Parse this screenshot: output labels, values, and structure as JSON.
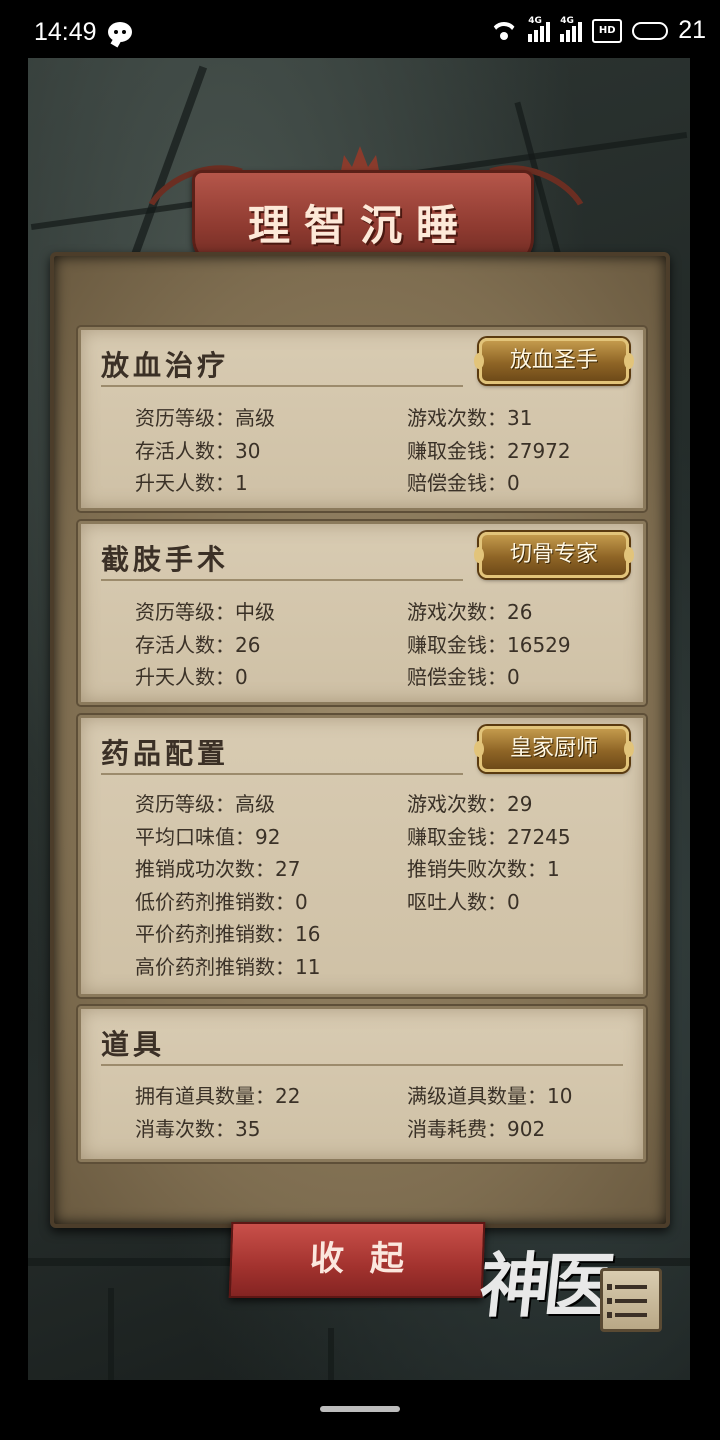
{
  "status_bar": {
    "time": "14:49",
    "battery": "21",
    "icons": [
      "chat-icon",
      "wifi-icon",
      "signal-icon",
      "signal-icon",
      "hd-icon",
      "battery-icon"
    ]
  },
  "banner": {
    "title": "理智沉睡"
  },
  "sections": [
    {
      "title": "放血治疗",
      "badge": "放血圣手",
      "left": [
        "资历等级：高级",
        "存活人数：30",
        "升天人数：1"
      ],
      "right": [
        "游戏次数：31",
        "赚取金钱：27972",
        "赔偿金钱：0"
      ]
    },
    {
      "title": "截肢手术",
      "badge": "切骨专家",
      "left": [
        "资历等级：中级",
        "存活人数：26",
        "升天人数：0"
      ],
      "right": [
        "游戏次数：26",
        "赚取金钱：16529",
        "赔偿金钱：0"
      ]
    },
    {
      "title": "药品配置",
      "badge": "皇家厨师",
      "left": [
        "资历等级：高级",
        "平均口味值：92",
        "推销成功次数：27",
        "低价药剂推销数：0",
        "平价药剂推销数：16",
        "高价药剂推销数：11"
      ],
      "right": [
        "游戏次数：29",
        "赚取金钱：27245",
        "推销失败次数：1",
        "呕吐人数：0"
      ]
    },
    {
      "title": "道具",
      "left": [
        "拥有道具数量：22",
        "消毒次数：35"
      ],
      "right": [
        "满级道具数量：10",
        "消毒耗费：902"
      ]
    }
  ],
  "collapse_button": {
    "label": "收起"
  },
  "logo": {
    "text": "神医"
  },
  "menu_button": {
    "icon": "list-menu-icon"
  }
}
